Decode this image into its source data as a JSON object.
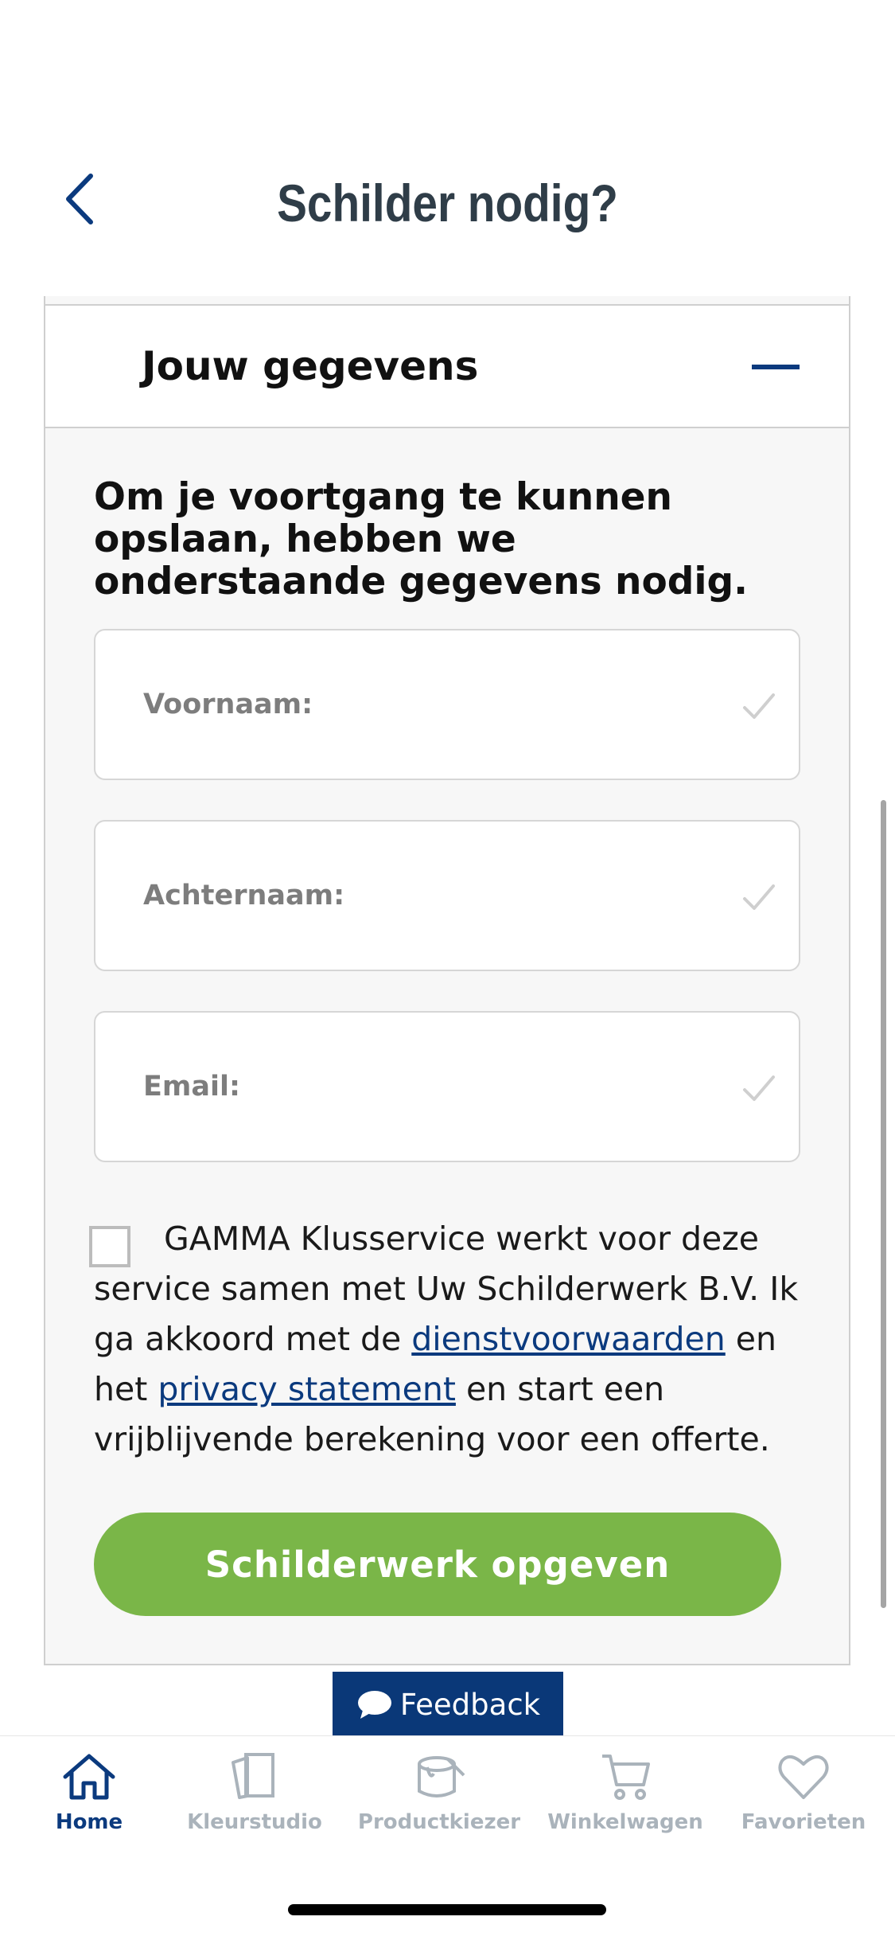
{
  "header": {
    "title": "Schilder nodig?"
  },
  "section": {
    "title": "Jouw gegevens"
  },
  "form": {
    "intro": "Om je voortgang te kunnen opslaan, hebben we onderstaande gegevens nodig.",
    "fields": [
      {
        "label": "Voornaam:"
      },
      {
        "label": "Achternaam:"
      },
      {
        "label": "Email:"
      }
    ],
    "consent": {
      "text_1": "GAMMA Klusservice werkt voor deze service samen met Uw Schilderwerk B.V. Ik ga akkoord met de ",
      "link_1": "dienstvoorwaarden",
      "text_2": " en het ",
      "link_2": "privacy statement",
      "text_3": " en start een vrijblijvende berekening voor een offerte."
    },
    "submit_label": "Schilderwerk opgeven"
  },
  "feedback": {
    "label": "Feedback"
  },
  "nav": {
    "items": [
      {
        "label": "Home",
        "icon": "home-icon"
      },
      {
        "label": "Kleurstudio",
        "icon": "color-swatch-icon"
      },
      {
        "label": "Productkiezer",
        "icon": "paint-bucket-icon"
      },
      {
        "label": "Winkelwagen",
        "icon": "cart-icon"
      },
      {
        "label": "Favorieten",
        "icon": "heart-icon"
      }
    ]
  },
  "colors": {
    "brand_blue": "#0b3a7e",
    "accent_green": "#7ab648",
    "nav_inactive": "#aab3bb"
  }
}
